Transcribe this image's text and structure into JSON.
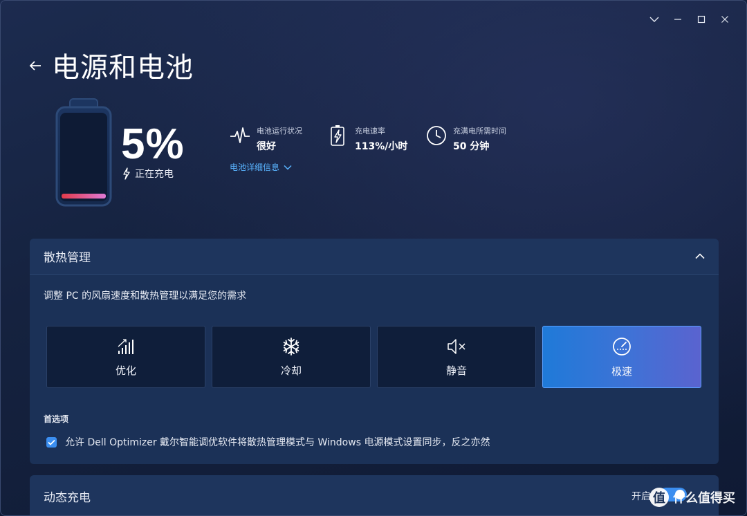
{
  "window": {
    "controls": [
      "chevron-down",
      "minimize",
      "maximize",
      "close"
    ]
  },
  "header": {
    "title": "电源和电池"
  },
  "battery": {
    "percent": "5%",
    "level": 0.05,
    "status": "正在充电",
    "colors": {
      "fill_start": "#e23b4a",
      "fill_end": "#e07ad6",
      "outline": "#2d4a78"
    }
  },
  "stats": [
    {
      "icon": "pulse-icon",
      "label": "电池运行状况",
      "value": "很好"
    },
    {
      "icon": "charging-battery-icon",
      "label": "充电速率",
      "value": "113%/小时"
    },
    {
      "icon": "clock-icon",
      "label": "充满电所需时间",
      "value": "50 分钟"
    }
  ],
  "details_link": "电池详细信息",
  "thermal": {
    "title": "散热管理",
    "description": "调整 PC 的风扇速度和散热管理以满足您的需求",
    "modes": [
      {
        "icon": "signal-bars-icon",
        "label": "优化",
        "active": false
      },
      {
        "icon": "snowflake-icon",
        "label": "冷却",
        "active": false
      },
      {
        "icon": "mute-icon",
        "label": "静音",
        "active": false
      },
      {
        "icon": "speedometer-icon",
        "label": "极速",
        "active": true
      }
    ],
    "preferences_title": "首选项",
    "sync_option": {
      "checked": true,
      "label": "允许 Dell Optimizer 戴尔智能调优软件将散热管理模式与 Windows 电源模式设置同步，反之亦然"
    }
  },
  "dynamic_charging": {
    "title": "动态充电",
    "state": "开启"
  },
  "watermark": {
    "text": "什么值得买",
    "badge": "值"
  },
  "colors": {
    "accent": "#3b8ef0",
    "link": "#59b4ff",
    "panel": "#1b3157",
    "active_mode_start": "#1f7ad8",
    "active_mode_end": "#5a63cf"
  }
}
